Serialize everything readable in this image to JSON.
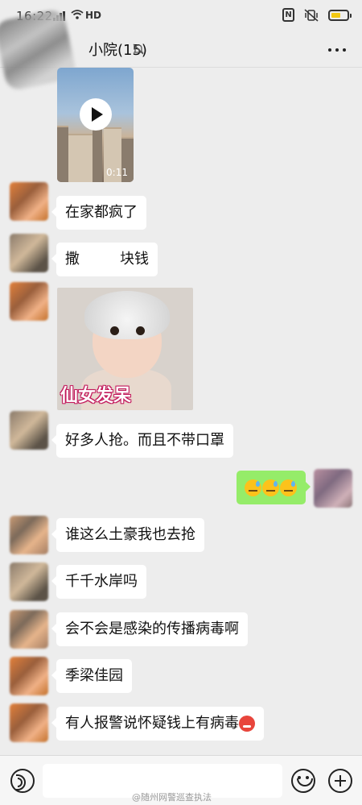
{
  "status_bar": {
    "time": "16:22",
    "network": "HD"
  },
  "header": {
    "title": "小院(15)",
    "muted": true
  },
  "messages": [
    {
      "from": "member",
      "type": "video",
      "duration": "0:11"
    },
    {
      "from": "member",
      "type": "text",
      "text": "在家都疯了"
    },
    {
      "from": "member",
      "type": "text",
      "text": "撒",
      "text_after": "块钱"
    },
    {
      "from": "member",
      "type": "sticker",
      "caption": "仙女发呆"
    },
    {
      "from": "member",
      "type": "text",
      "text": "好多人抢。而且不带口罩"
    },
    {
      "from": "me",
      "type": "emoji",
      "emoji": [
        "sweat-smile",
        "sweat-smile",
        "sweat-smile"
      ]
    },
    {
      "from": "member",
      "type": "text",
      "text": "谁这么土豪我也去抢"
    },
    {
      "from": "member",
      "type": "text",
      "text": "千千水岸吗"
    },
    {
      "from": "member",
      "type": "text",
      "text": "会不会是感染的传播病毒啊"
    },
    {
      "from": "member",
      "type": "text",
      "text": "季梁佳园"
    },
    {
      "from": "member",
      "type": "text",
      "text": "有人报警说怀疑钱上有病毒"
    }
  ],
  "watermark": "@随州网警巡查执法",
  "colors": {
    "background": "#ededed",
    "my_bubble": "#95ec69",
    "their_bubble": "#ffffff",
    "battery": "#f2c813"
  }
}
